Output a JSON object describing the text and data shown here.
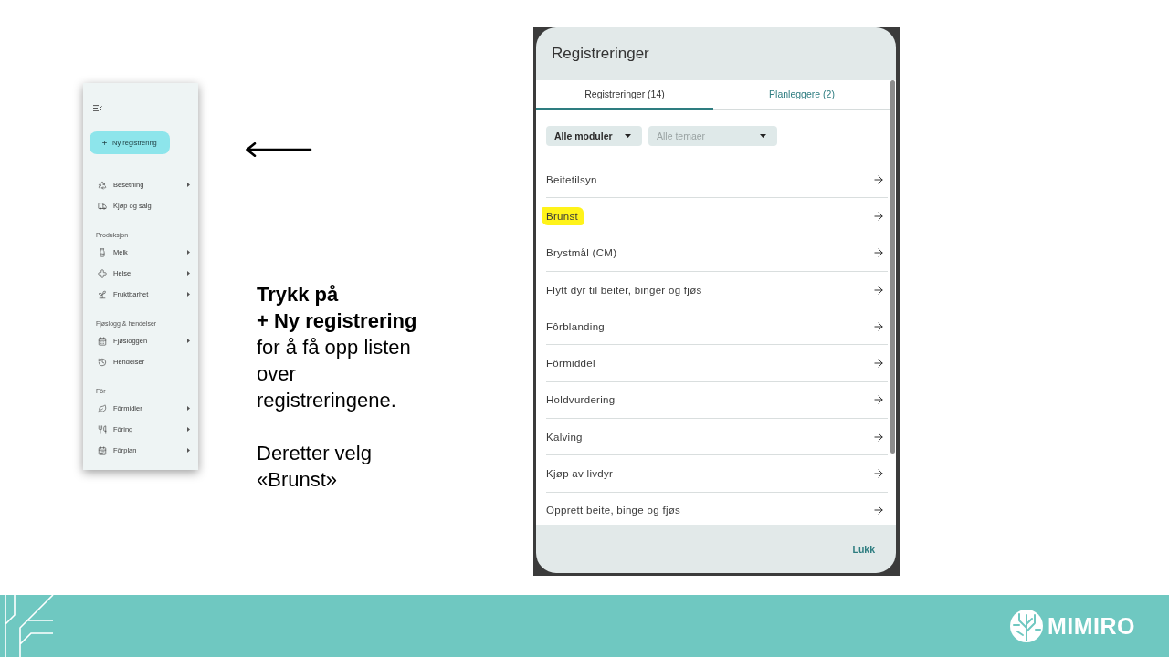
{
  "sidebar": {
    "new_button": {
      "label": "Ny registrering"
    },
    "top_items": [
      {
        "label": "Besetning",
        "submenu": true
      },
      {
        "label": "Kjøp og salg",
        "submenu": false
      }
    ],
    "sections": [
      {
        "title": "Produksjon",
        "items": [
          {
            "label": "Melk",
            "submenu": true
          },
          {
            "label": "Helse",
            "submenu": true
          },
          {
            "label": "Fruktbarhet",
            "submenu": true
          }
        ]
      },
      {
        "title": "Fjøslogg & hendelser",
        "items": [
          {
            "label": "Fjøsloggen",
            "submenu": true
          },
          {
            "label": "Hendelser",
            "submenu": false
          }
        ]
      },
      {
        "title": "Fôr",
        "items": [
          {
            "label": "Fôrmidler",
            "submenu": true
          },
          {
            "label": "Fôring",
            "submenu": true
          },
          {
            "label": "Fôrplan",
            "submenu": true
          }
        ]
      }
    ]
  },
  "instructions": [
    {
      "lines": [
        {
          "text": "Trykk på",
          "bold": true
        },
        {
          "text": "+ Ny registrering",
          "bold": true
        },
        {
          "text": "for å få opp listen",
          "bold": false
        },
        {
          "text": "over",
          "bold": false
        },
        {
          "text": "registreringene.",
          "bold": false
        }
      ]
    },
    {
      "lines": [
        {
          "text": "Deretter velg",
          "bold": false
        },
        {
          "text": "«Brunst»",
          "bold": false
        }
      ]
    }
  ],
  "dialog": {
    "title": "Registreringer",
    "tabs": [
      {
        "label": "Registreringer (14)",
        "selected": true
      },
      {
        "label": "Planleggere (2)",
        "selected": false
      }
    ],
    "filters": [
      {
        "value": "Alle moduler"
      },
      {
        "placeholder": "Alle temaer"
      }
    ],
    "items": [
      {
        "label": "Beitetilsyn",
        "highlighted": false
      },
      {
        "label": "Brunst",
        "highlighted": true
      },
      {
        "label": "Brystmål (CM)",
        "highlighted": false
      },
      {
        "label": "Flytt dyr til beiter, binger og fjøs",
        "highlighted": false
      },
      {
        "label": "Fôrblanding",
        "highlighted": false
      },
      {
        "label": "Fôrmiddel",
        "highlighted": false
      },
      {
        "label": "Holdvurdering",
        "highlighted": false
      },
      {
        "label": "Kalving",
        "highlighted": false
      },
      {
        "label": "Kjøp av livdyr",
        "highlighted": false
      },
      {
        "label": "Opprett beite, binge og fjøs",
        "highlighted": false
      }
    ],
    "close_button": "Lukk"
  },
  "footer": {
    "brand": "MIMIRO"
  }
}
